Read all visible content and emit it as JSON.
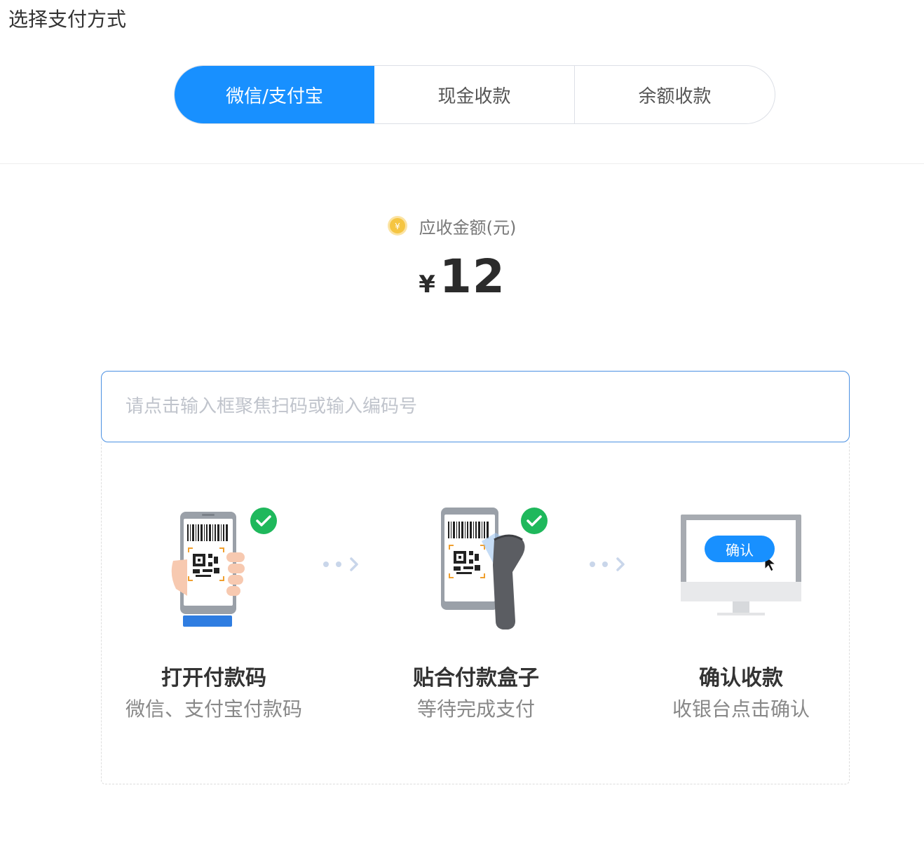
{
  "page": {
    "title": "选择支付方式"
  },
  "tabs": [
    {
      "label": "微信/支付宝",
      "active": true
    },
    {
      "label": "现金收款",
      "active": false
    },
    {
      "label": "余额收款",
      "active": false
    }
  ],
  "amount": {
    "label": "应收金额(元)",
    "currency_symbol": "¥",
    "value": "12"
  },
  "scan": {
    "placeholder": "请点击输入框聚焦扫码或输入编码号",
    "value": ""
  },
  "steps": [
    {
      "title": "打开付款码",
      "desc": "微信、支付宝付款码",
      "icon": "phone-payment-code-icon"
    },
    {
      "title": "贴合付款盒子",
      "desc": "等待完成支付",
      "icon": "barcode-scanner-icon"
    },
    {
      "title": "确认收款",
      "desc": "收银台点击确认",
      "icon": "monitor-confirm-icon"
    }
  ],
  "confirm_screen_button": "确认",
  "colors": {
    "accent": "#1890ff",
    "success": "#1fb85c",
    "coin": "#f5c542"
  }
}
